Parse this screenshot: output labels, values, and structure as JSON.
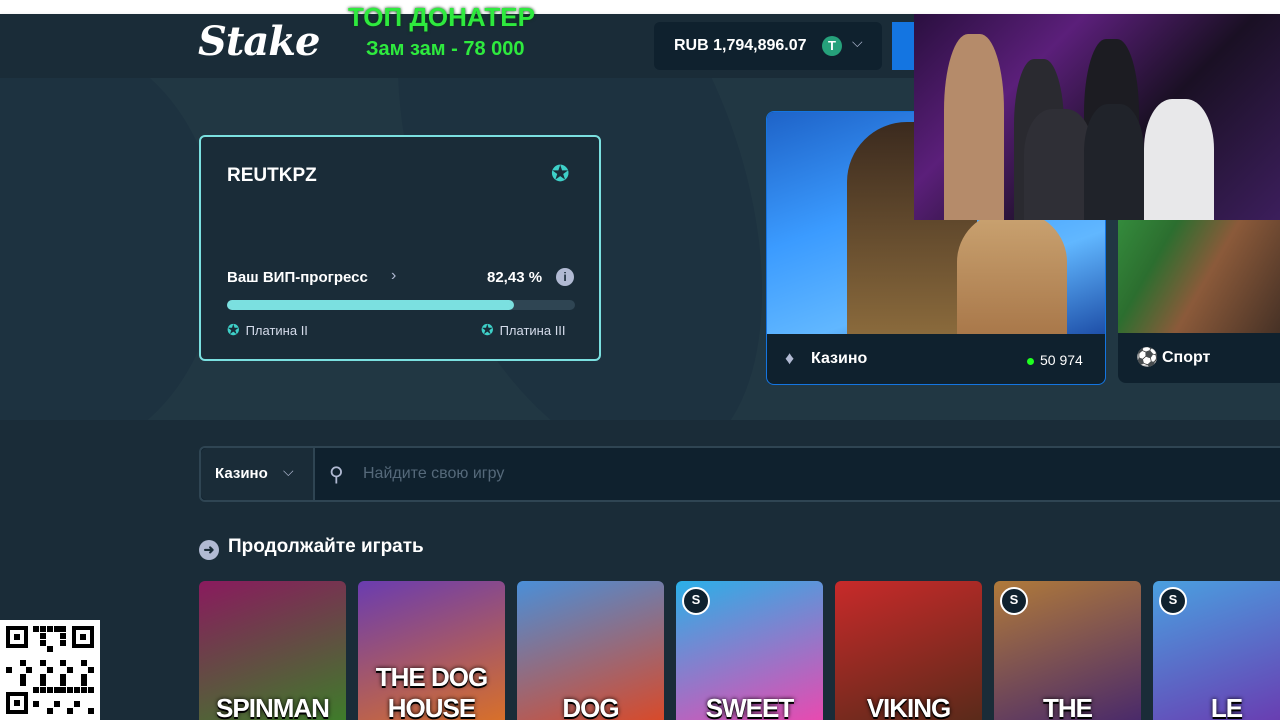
{
  "overlay": {
    "title": "ТОП ДОНАТЕР",
    "subtitle": "Зам зам - 78 000"
  },
  "header": {
    "logo": "Stake",
    "wallet_text": "RUB 1,794,896.07",
    "currency_icon": "tether-icon",
    "tether_glyph": "T"
  },
  "vip": {
    "username": "REUTKPZ",
    "progress_label": "Ваш ВИП-прогресс",
    "progress_text": "82,43 %",
    "progress_value": 0.8243,
    "current_tier": "Платина II",
    "next_tier": "Платина III"
  },
  "cards": {
    "casino": {
      "label": "Казино",
      "online": "50 974"
    },
    "sport": {
      "label": "Спорт"
    }
  },
  "search": {
    "category": "Казино",
    "placeholder": "Найдите свою игру"
  },
  "continue_section": {
    "title": "Продолжайте играть"
  },
  "games": [
    {
      "title": "SPINMAN",
      "colors": [
        "#8a1a5e",
        "#3e7c2a"
      ],
      "badge": false
    },
    {
      "title": "THE DOG HOUSE",
      "colors": [
        "#6a3cb0",
        "#d8702a"
      ],
      "badge": false
    },
    {
      "title": "DOG",
      "colors": [
        "#4a8fd8",
        "#d84a2a"
      ],
      "badge": false
    },
    {
      "title": "SWEET",
      "colors": [
        "#2ab0e8",
        "#e84ab0"
      ],
      "badge": true
    },
    {
      "title": "VIKING",
      "colors": [
        "#c82a2a",
        "#5a2a1a"
      ],
      "badge": false
    },
    {
      "title": "THE",
      "colors": [
        "#b07a3a",
        "#4a2a6a"
      ],
      "badge": true
    },
    {
      "title": "LE",
      "colors": [
        "#4aa0e0",
        "#6a3ab0"
      ],
      "badge": true
    }
  ],
  "badge_glyph": "S",
  "colors": {
    "accent": "#7be0e0",
    "online": "#1fff20",
    "overlay_text": "#2eea3e",
    "bg": "#1a2c38"
  }
}
